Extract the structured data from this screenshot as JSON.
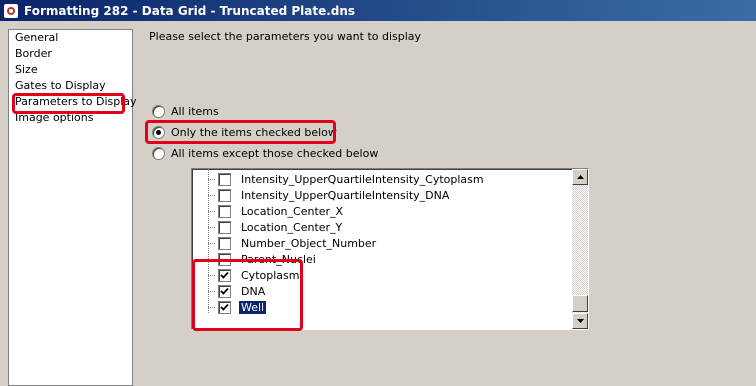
{
  "window": {
    "title": "Formatting 282 - Data Grid - Truncated Plate.dns"
  },
  "nav": {
    "items": [
      {
        "label": "General",
        "selected": false
      },
      {
        "label": "Border",
        "selected": false
      },
      {
        "label": "Size",
        "selected": false
      },
      {
        "label": "Gates to Display",
        "selected": false
      },
      {
        "label": "Parameters to Display",
        "selected": true
      },
      {
        "label": "Image options",
        "selected": false
      }
    ]
  },
  "main": {
    "instruction": "Please select the parameters you want to display",
    "options": [
      {
        "label": "All items",
        "checked": false
      },
      {
        "label": "Only the items checked below",
        "checked": true
      },
      {
        "label": "All items except those checked below",
        "checked": false
      }
    ],
    "parameters": [
      {
        "label": "Intensity_UpperQuartileIntensity_Cytoplasm",
        "checked": false,
        "selected": false
      },
      {
        "label": "Intensity_UpperQuartileIntensity_DNA",
        "checked": false,
        "selected": false
      },
      {
        "label": "Location_Center_X",
        "checked": false,
        "selected": false
      },
      {
        "label": "Location_Center_Y",
        "checked": false,
        "selected": false
      },
      {
        "label": "Number_Object_Number",
        "checked": false,
        "selected": false
      },
      {
        "label": "Parent_Nuclei",
        "checked": false,
        "selected": false
      },
      {
        "label": "Cytoplasm",
        "checked": true,
        "selected": false
      },
      {
        "label": "DNA",
        "checked": true,
        "selected": false
      },
      {
        "label": "Well",
        "checked": true,
        "selected": true
      }
    ]
  },
  "colors": {
    "highlight": "#e0001b",
    "title_bar": "#0a246a",
    "selection": "#0a246a"
  },
  "icons": {
    "app": "app-icon",
    "scroll_up": "scroll-up-arrow-icon",
    "scroll_down": "scroll-down-arrow-icon",
    "check": "check-icon"
  }
}
